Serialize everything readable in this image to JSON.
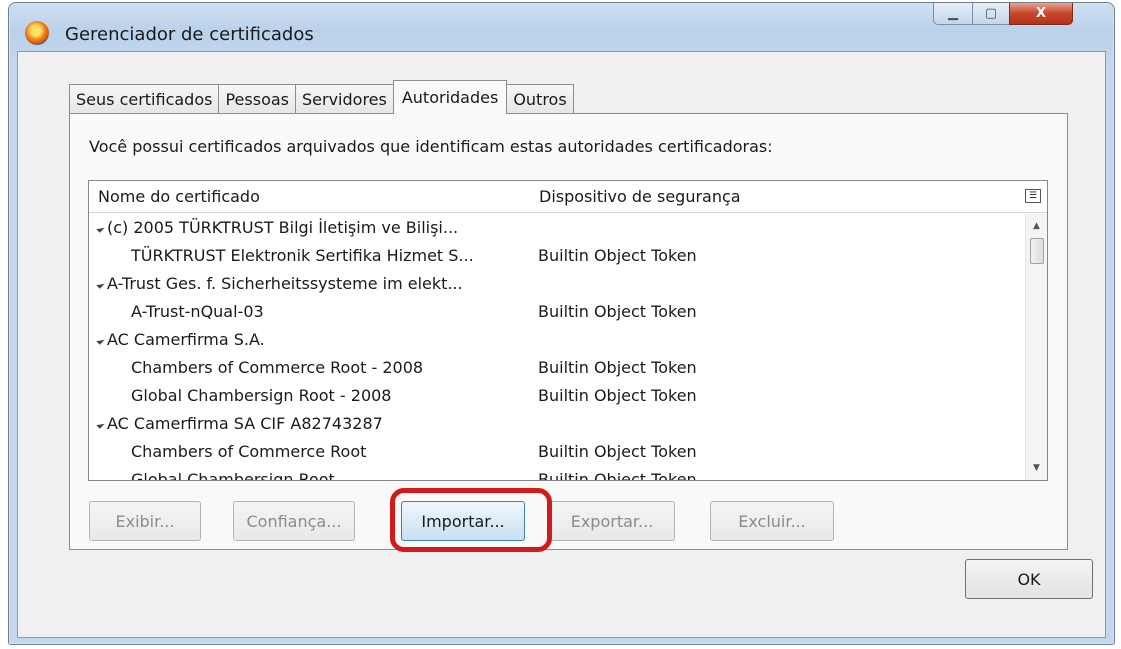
{
  "window": {
    "title": "Gerenciador de certificados",
    "buttons": {
      "minimize": "▁",
      "maximize": "▢",
      "close": "X"
    }
  },
  "tabs": [
    {
      "label": "Seus certificados",
      "active": false
    },
    {
      "label": "Pessoas",
      "active": false
    },
    {
      "label": "Servidores",
      "active": false
    },
    {
      "label": "Autoridades",
      "active": true
    },
    {
      "label": "Outros",
      "active": false
    }
  ],
  "panel": {
    "description": "Você possui certificados arquivados que identificam estas autoridades certificadoras:"
  },
  "tree": {
    "columns": {
      "name": "Nome do certificado",
      "device": "Dispositivo de segurança"
    },
    "rows": [
      {
        "type": "group",
        "name": "(c) 2005 TÜRKTRUST Bilgi İletişim ve Bilişi...",
        "device": ""
      },
      {
        "type": "child",
        "name": "TÜRKTRUST Elektronik Sertifika Hizmet S...",
        "device": "Builtin Object Token"
      },
      {
        "type": "group",
        "name": "A-Trust Ges. f. Sicherheitssysteme im elekt...",
        "device": ""
      },
      {
        "type": "child",
        "name": "A-Trust-nQual-03",
        "device": "Builtin Object Token"
      },
      {
        "type": "group",
        "name": "AC Camerfirma S.A.",
        "device": ""
      },
      {
        "type": "child",
        "name": "Chambers of Commerce Root - 2008",
        "device": "Builtin Object Token"
      },
      {
        "type": "child",
        "name": "Global Chambersign Root - 2008",
        "device": "Builtin Object Token"
      },
      {
        "type": "group",
        "name": "AC Camerfirma SA CIF A82743287",
        "device": ""
      },
      {
        "type": "child",
        "name": "Chambers of Commerce Root",
        "device": "Builtin Object Token"
      },
      {
        "type": "child",
        "name": "Global Chambersign Root",
        "device": "Builtin Object Token"
      }
    ]
  },
  "actions": {
    "view": "Exibir...",
    "trust": "Confiança...",
    "import": "Importar...",
    "export": "Exportar...",
    "delete": "Excluir..."
  },
  "footer": {
    "ok": "OK"
  }
}
